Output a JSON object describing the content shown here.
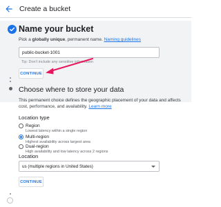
{
  "header": {
    "title": "Create a bucket",
    "back_icon": "arrow-back-icon"
  },
  "step1": {
    "title": "Name your bucket",
    "subtitle_prefix": "Pick a ",
    "subtitle_bold": "globally unique",
    "subtitle_suffix": ", permanent name. ",
    "guidelines_link": "Naming guidelines",
    "input_value": "public-bucket-1001",
    "hint": "Tip: Don't include any sensitive information",
    "continue_label": "CONTINUE",
    "status_icon": "check-circle-icon"
  },
  "step2": {
    "title": "Choose where to store your data",
    "description": "This permanent choice defines the geographic placement of your data and affects cost, performance, and availability.",
    "learn_more": "Learn more",
    "location_type_label": "Location type",
    "options": [
      {
        "label": "Region",
        "sub": "Lowest latency within a single region",
        "checked": false
      },
      {
        "label": "Multi-region",
        "sub": "Highest availability across largest area",
        "checked": true
      },
      {
        "label": "Dual-region",
        "sub": "High availability and low latency across 2 regions",
        "checked": false
      }
    ],
    "location_label": "Location",
    "location_value": "us (multiple regions in United States)",
    "continue_label": "CONTINUE"
  },
  "colors": {
    "accent": "#1a73e8",
    "annotation": "#e8175d",
    "step_bg": "#f1f3f4"
  }
}
